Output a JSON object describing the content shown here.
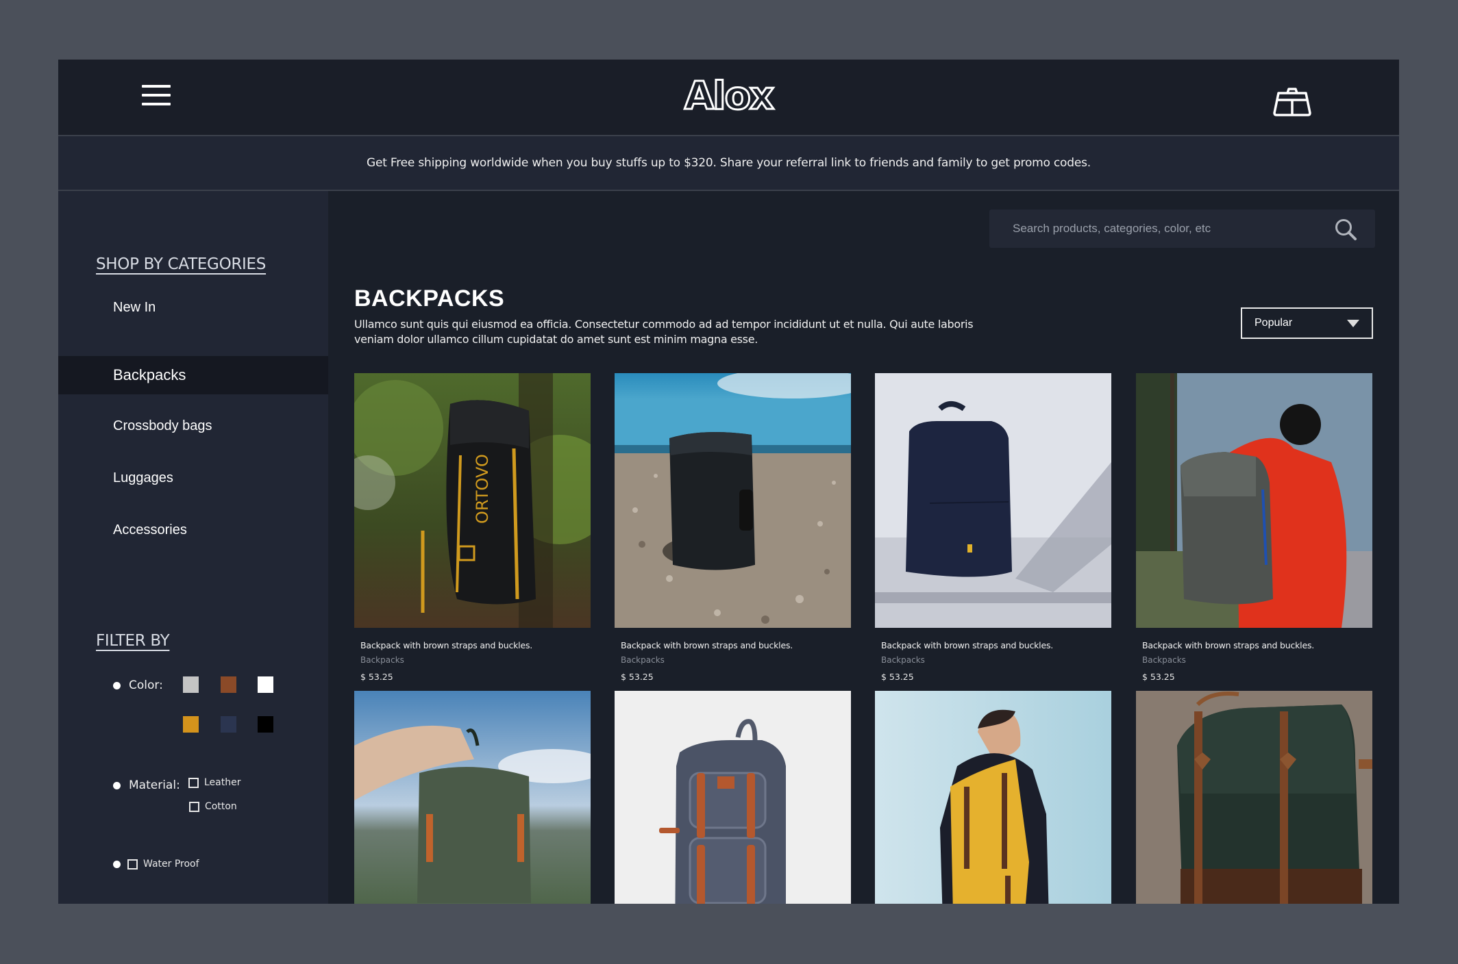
{
  "header": {
    "menu_icon": "hamburger-icon",
    "logo": "Alox",
    "bag_icon": "shopping-bag-icon"
  },
  "banner": {
    "text": "Get Free shipping worldwide when you buy stuffs up to $320. Share your referral link to friends and family to get promo codes."
  },
  "sidebar": {
    "categories_title": "SHOP BY CATEGORIES",
    "categories": [
      {
        "label": "New In",
        "active": false
      },
      {
        "label": "Backpacks",
        "active": true
      },
      {
        "label": "Crossbody bags",
        "active": false
      },
      {
        "label": "Luggages",
        "active": false
      },
      {
        "label": "Accessories",
        "active": false
      }
    ],
    "filter_title": "FILTER BY",
    "color_label": "Color:",
    "colors": [
      "#c4c4c4",
      "#8b4a28",
      "#ffffff",
      "#d4931c",
      "#2b3550",
      "#000000"
    ],
    "material_label": "Material:",
    "materials": [
      {
        "label": "Leather",
        "checked": false
      },
      {
        "label": "Cotton",
        "checked": false
      }
    ],
    "waterproof": {
      "label": "Water Proof",
      "checked": false
    }
  },
  "search": {
    "placeholder": "Search products, categories, color, etc",
    "value": "",
    "icon": "search-icon"
  },
  "main": {
    "title": "BACKPACKS",
    "description": "Ullamco sunt quis qui eiusmod ea officia. Consectetur commodo ad ad tempor incididunt ut et nulla. Qui aute laboris veniam dolor ullamco cillum cupidatat do amet sunt est minim magna esse.",
    "sort": {
      "selected": "Popular"
    }
  },
  "products": [
    {
      "title": "Backpack with brown straps and buckles.",
      "category": "Backpacks",
      "price": "$ 53.25",
      "image": "black-yellow-backpack-on-tree"
    },
    {
      "title": "Backpack with brown straps and buckles.",
      "category": "Backpacks",
      "price": "$ 53.25",
      "image": "black-backpack-on-pebble-beach"
    },
    {
      "title": "Backpack with brown straps and buckles.",
      "category": "Backpacks",
      "price": "$ 53.25",
      "image": "navy-backpack-on-white-floor"
    },
    {
      "title": "Backpack with brown straps and buckles.",
      "category": "Backpacks",
      "price": "$ 53.25",
      "image": "grey-backpack-on-person-red-hoodie"
    },
    {
      "title": "",
      "category": "",
      "price": "",
      "image": "green-backpack-held-over-mountains"
    },
    {
      "title": "",
      "category": "",
      "price": "",
      "image": "grey-canvas-backpack-leather-straps"
    },
    {
      "title": "",
      "category": "",
      "price": "",
      "image": "yellow-backpack-on-man"
    },
    {
      "title": "",
      "category": "",
      "price": "",
      "image": "dark-green-leather-backpack"
    }
  ]
}
